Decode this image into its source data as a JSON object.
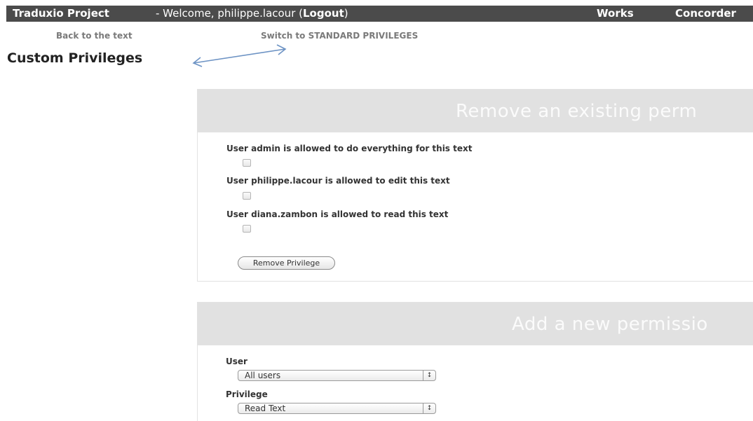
{
  "topbar": {
    "project": "Traduxio Project",
    "welcome_prefix": "- Welcome, philippe.lacour (",
    "logout": "Logout",
    "welcome_suffix": ")",
    "nav": {
      "works": "Works",
      "concorder": "Concorder"
    }
  },
  "links": {
    "back": "Back to the text",
    "switch": "Switch to STANDARD PRIVILEGES"
  },
  "page_title": "Custom Privileges",
  "remove_panel": {
    "heading": "Remove an existing perm",
    "permissions": [
      {
        "text": "User admin is allowed to do everything for this text",
        "checked": false
      },
      {
        "text": "User philippe.lacour is allowed to edit this text",
        "checked": false
      },
      {
        "text": "User diana.zambon is allowed to read this text",
        "checked": false
      }
    ],
    "button_label": "Remove Privilege"
  },
  "add_panel": {
    "heading": "Add a new permissio",
    "user_label": "User",
    "user_value": "All users",
    "privilege_label": "Privilege",
    "privilege_value": "Read Text"
  },
  "colors": {
    "topbar_bg": "#4b4b4b",
    "panel_header_bg": "#e1e1e1",
    "arrow": "#6d93c4"
  },
  "icons": {
    "select_arrow": "up-down-chevron-icon",
    "annotation_arrow": "double-arrow-icon"
  }
}
